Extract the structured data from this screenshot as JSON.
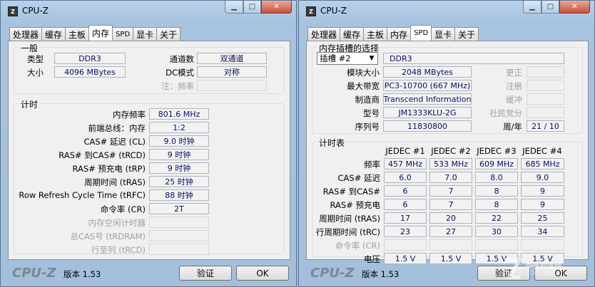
{
  "left": {
    "title": "CPU-Z",
    "tabs": [
      "处理器",
      "缓存",
      "主板",
      "内存",
      "SPD",
      "显卡",
      "关于"
    ],
    "general": {
      "legend": "一般",
      "type_label": "类型",
      "type_value": "DDR3",
      "size_label": "大小",
      "size_value": "4096 MBytes",
      "channels_label": "通道数",
      "channels_value": "双通道",
      "dc_label": "DC模式",
      "dc_value": "对称",
      "freq_note_label": "注：频率"
    },
    "timing": {
      "legend": "计时",
      "rows": [
        {
          "label": "内存频率",
          "value": "801.6 MHz"
        },
        {
          "label": "前端总线：内存",
          "value": "1:2"
        },
        {
          "label": "CAS# 延迟 (CL)",
          "value": "9.0 时钟"
        },
        {
          "label": "RAS# 到CAS# (tRCD)",
          "value": "9 时钟"
        },
        {
          "label": "RAS# 预充电 (tRP)",
          "value": "9 时钟"
        },
        {
          "label": "周期时间 (tRAS)",
          "value": "25 时钟"
        },
        {
          "label": "Row Refresh Cycle Time (tRFC)",
          "value": "88 时钟"
        },
        {
          "label": "命令率 (CR)",
          "value": "2T"
        },
        {
          "label": "内存空闲计时器",
          "value": ""
        },
        {
          "label": "总CAS号 (tRDRAM)",
          "value": ""
        },
        {
          "label": "行至列 (tRCD)",
          "value": ""
        }
      ]
    },
    "footer": {
      "brand": "CPU-Z",
      "version": "版本 1.53",
      "validate": "验证",
      "ok": "OK"
    }
  },
  "right": {
    "title": "CPU-Z",
    "tabs": [
      "处理器",
      "缓存",
      "主板",
      "内存",
      "SPD",
      "显卡",
      "关于"
    ],
    "slot": {
      "legend": "内存插槽的选择",
      "slot_value": "插槽 #2",
      "module_type": "DDR3",
      "rows": [
        {
          "label": "模块大小",
          "value": "2048 MBytes",
          "rlabel": "更正",
          "rvalue": ""
        },
        {
          "label": "最大带宽",
          "value": "PC3-10700 (667 MHz)",
          "rlabel": "注册",
          "rvalue": ""
        },
        {
          "label": "制造商",
          "value": "Transcend Information",
          "rlabel": "缓冲",
          "rvalue": ""
        },
        {
          "label": "型号",
          "value": "JM1333KLU-2G",
          "rlabel": "社民党分",
          "rvalue": ""
        },
        {
          "label": "序列号",
          "value": "11830800",
          "rlabel": "周/年",
          "rvalue": "21 / 10"
        }
      ]
    },
    "timing_table": {
      "legend": "计时表",
      "columns": [
        "JEDEC #1",
        "JEDEC #2",
        "JEDEC #3",
        "JEDEC #4"
      ],
      "rows": [
        {
          "label": "频率",
          "values": [
            "457 MHz",
            "533 MHz",
            "609 MHz",
            "685 MHz"
          ]
        },
        {
          "label": "CAS# 延迟",
          "values": [
            "6.0",
            "7.0",
            "8.0",
            "9.0"
          ]
        },
        {
          "label": "RAS# 到CAS#",
          "values": [
            "6",
            "7",
            "8",
            "9"
          ]
        },
        {
          "label": "RAS# 预充电",
          "values": [
            "6",
            "7",
            "8",
            "9"
          ]
        },
        {
          "label": "周期时间 (tRAS)",
          "values": [
            "17",
            "20",
            "22",
            "25"
          ]
        },
        {
          "label": "行周期时间 (tRC)",
          "values": [
            "23",
            "27",
            "30",
            "34"
          ]
        },
        {
          "label": "命令率 (CR)",
          "values": [
            "",
            "",
            "",
            ""
          ]
        },
        {
          "label": "电压",
          "values": [
            "1.5 V",
            "1.5 V",
            "1.5 V",
            "1.5 V"
          ]
        }
      ]
    },
    "footer": {
      "brand": "CPU-Z",
      "version": "版本 1.53",
      "validate": "验证",
      "ok": "OK"
    }
  },
  "watermark": {
    "text": "中关村在线",
    "url": "ZOL.com.cn"
  }
}
